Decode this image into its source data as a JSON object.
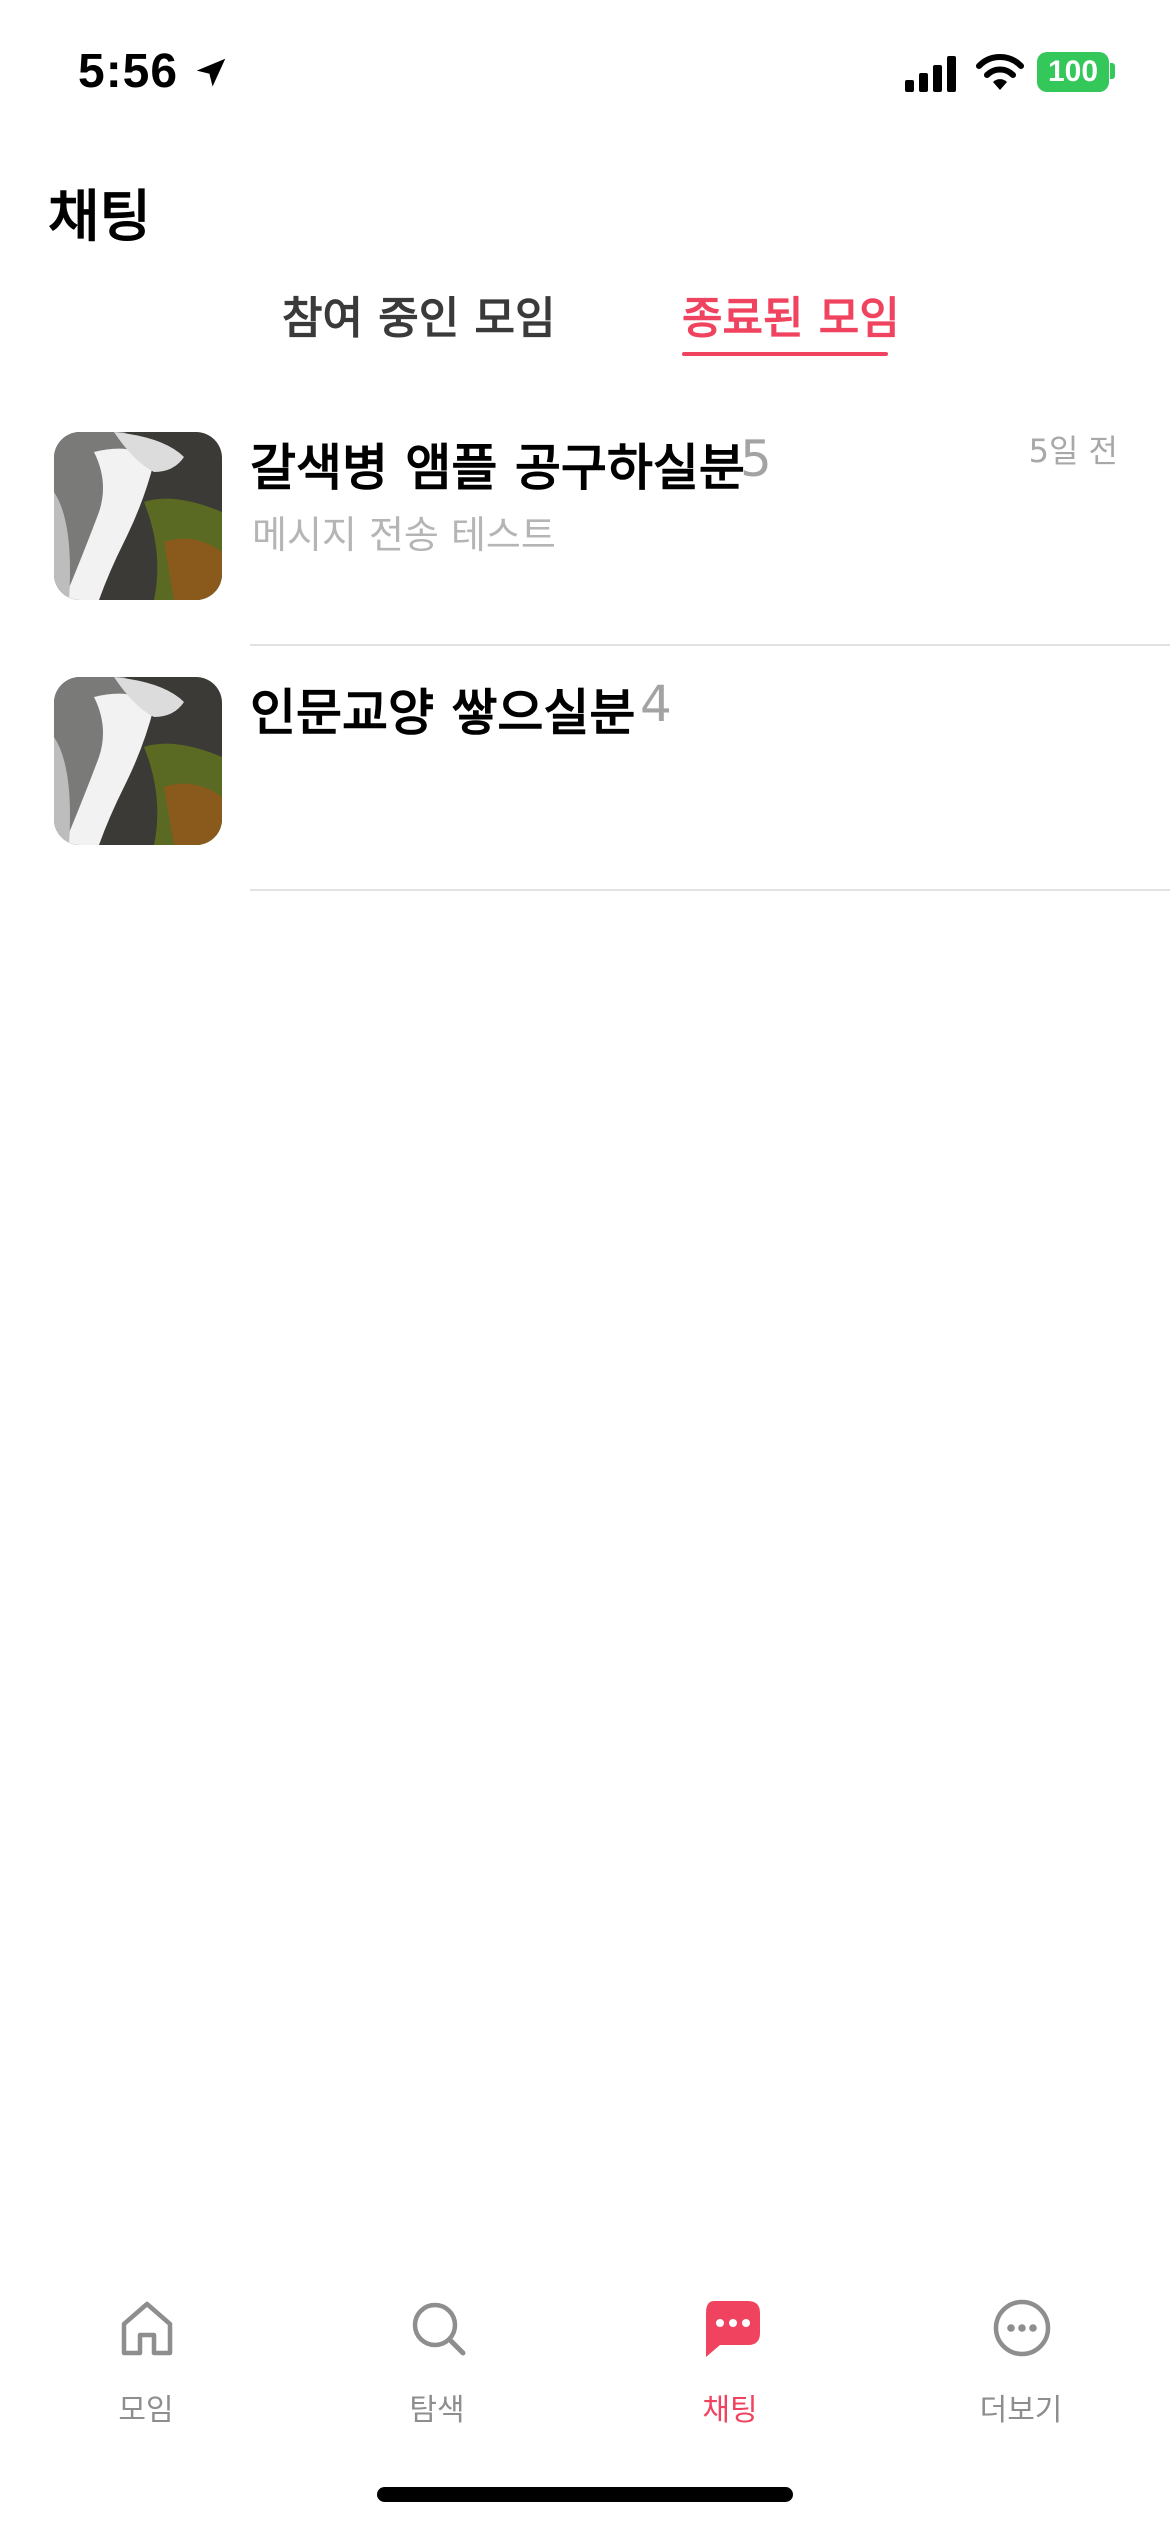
{
  "status_bar": {
    "time": "5:56",
    "battery": "100",
    "icons": [
      "location-arrow-icon",
      "cellular-signal-icon",
      "wifi-icon",
      "battery-icon"
    ]
  },
  "header": {
    "title": "채팅"
  },
  "tabs": [
    {
      "label": "참여 중인 모임",
      "active": false
    },
    {
      "label": "종료된 모임",
      "active": true
    }
  ],
  "chats": [
    {
      "title": "갈색병 앰플 공구하실분",
      "count": "5",
      "preview": "메시지 전송 테스트",
      "time": "5일 전",
      "thumbnail": "waterfall-photo"
    },
    {
      "title": "인문교양 쌓으실분",
      "count": "4",
      "preview": "",
      "time": "",
      "thumbnail": "waterfall-photo"
    }
  ],
  "bottom_nav": [
    {
      "label": "모임",
      "icon": "home-icon",
      "active": false
    },
    {
      "label": "탐색",
      "icon": "search-icon",
      "active": false
    },
    {
      "label": "채팅",
      "icon": "chat-bubble-icon",
      "active": true
    },
    {
      "label": "더보기",
      "icon": "more-circle-icon",
      "active": false
    }
  ],
  "colors": {
    "accent": "#f0435f",
    "battery": "#34c759",
    "muted_text": "#a3a3a3",
    "divider": "#e2e2e2"
  }
}
